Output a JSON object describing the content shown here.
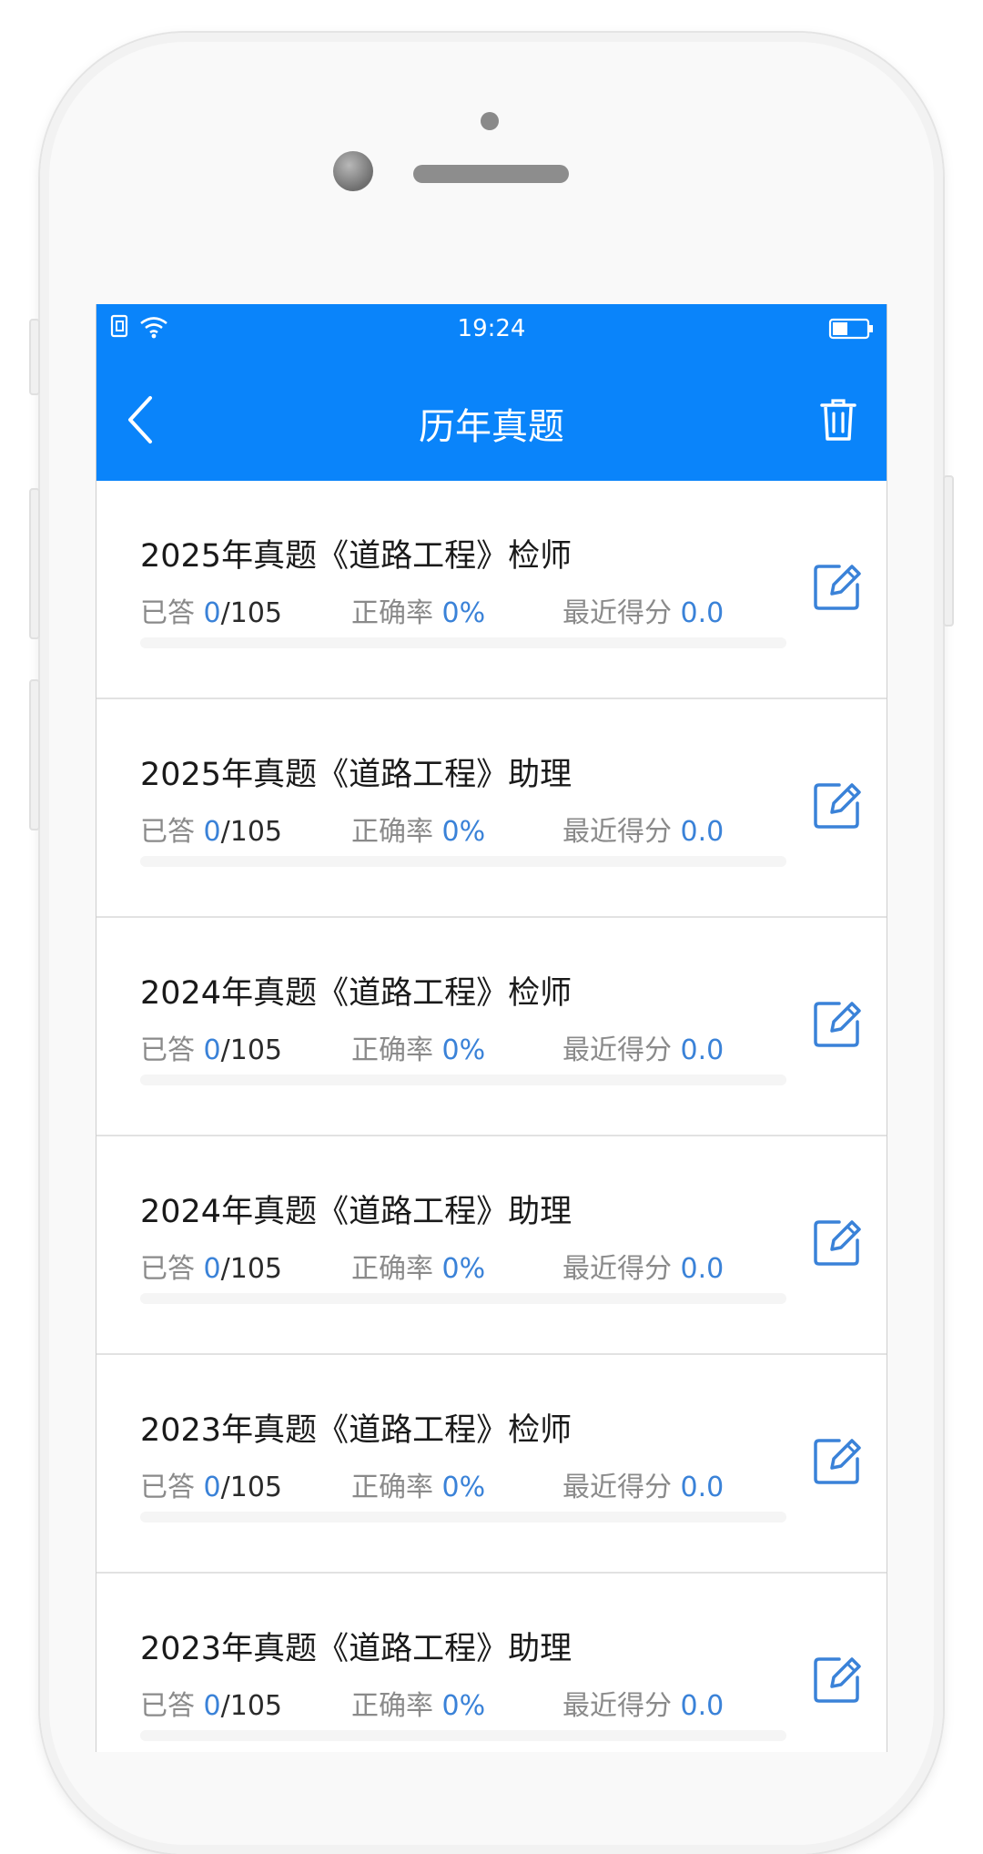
{
  "status_bar": {
    "time": "19:24",
    "left_icons": [
      "sim-icon",
      "wifi-icon"
    ],
    "right_icons": [
      "battery-icon"
    ]
  },
  "nav": {
    "title": "历年真题",
    "back_icon": "chevron-left-icon",
    "action_icon": "trash-icon"
  },
  "colors": {
    "accent": "#0a84fa",
    "value_blue": "#3a82d8",
    "label_gray": "#8a8a8a"
  },
  "labels": {
    "answered": "已答",
    "accuracy": "正确率",
    "recent_score": "最近得分"
  },
  "items": [
    {
      "title": "2025年真题《道路工程》检师",
      "answered": "0",
      "total": "/105",
      "accuracy": "0%",
      "score": "0.0",
      "progress": 0
    },
    {
      "title": "2025年真题《道路工程》助理",
      "answered": "0",
      "total": "/105",
      "accuracy": "0%",
      "score": "0.0",
      "progress": 0
    },
    {
      "title": "2024年真题《道路工程》检师",
      "answered": "0",
      "total": "/105",
      "accuracy": "0%",
      "score": "0.0",
      "progress": 0
    },
    {
      "title": "2024年真题《道路工程》助理",
      "answered": "0",
      "total": "/105",
      "accuracy": "0%",
      "score": "0.0",
      "progress": 0
    },
    {
      "title": "2023年真题《道路工程》检师",
      "answered": "0",
      "total": "/105",
      "accuracy": "0%",
      "score": "0.0",
      "progress": 0
    },
    {
      "title": "2023年真题《道路工程》助理",
      "answered": "0",
      "total": "/105",
      "accuracy": "0%",
      "score": "0.0",
      "progress": 0
    }
  ]
}
